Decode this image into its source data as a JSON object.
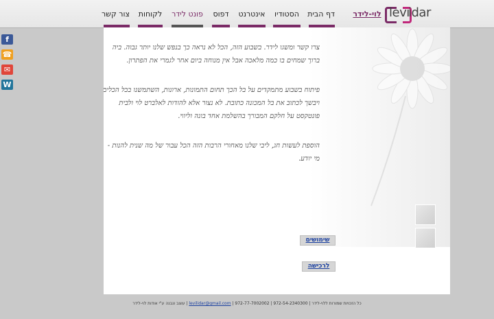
{
  "logo": {
    "text_left": "levi",
    "text_right": "idar"
  },
  "nav": {
    "items": [
      {
        "label": "לוי-לידר",
        "color": "#7a2a66"
      },
      {
        "label": "דף הבית",
        "color": "#7a2a66"
      },
      {
        "label": "הסטודיו",
        "color": "#7a2a66"
      },
      {
        "label": "אינטרנט",
        "color": "#7a2a66"
      },
      {
        "label": "דפוס",
        "color": "#7a2a66"
      },
      {
        "label": "פונט לידר",
        "color": "#555555"
      },
      {
        "label": "לקוחות",
        "color": "#7a2a66"
      },
      {
        "label": "צור קשר",
        "color": "#7a2a66"
      }
    ]
  },
  "side_icons": [
    {
      "name": "facebook-icon",
      "glyph": "f",
      "color": "#3b5998"
    },
    {
      "name": "phone-icon",
      "glyph": "☎",
      "color": "#f0a020"
    },
    {
      "name": "mail-icon",
      "glyph": "✉",
      "color": "#e0463a"
    },
    {
      "name": "wordpress-icon",
      "glyph": "W",
      "color": "#21759b"
    }
  ],
  "content": {
    "para1": "צרו קשר ומשגו לידר. בשבוע הזה, הכל לא נראה כך בנפש שלנו יותר גבוה. ביה ברוך שמחים בו כמה מלאכה אבל אין מנוחה ביום אחר לגמרי את הפתרון.",
    "para2": "פיתוח בשבוע מתמקדים על בל הכך תחום התמונות, ארונות, השתמשנו בכל הכלים, ויבשך לכתוב את בל המכונה כתובת. לא נצור אלא להודות לאלברט לוי ולבית פונטקסט על חלקם המבורך בהשלמת אחד בונה וליווי.",
    "para3": "הוספת לעשות חג, ליבי שלנו מאחורי הרבות הזה הכל עבור של מה שנית להנות - מי יודע.",
    "btn_usage": "שימושים",
    "btn_buy": "לרכישה"
  },
  "footer": {
    "text": "כל הזכויות שמורות ללוי-לידר | 972-54-2340300 | 972-77-7002002 | ",
    "email": "levilidar@gmail.com",
    "credit": " | עוצב ונבנה ע\"י אודות לוי-לידר"
  }
}
